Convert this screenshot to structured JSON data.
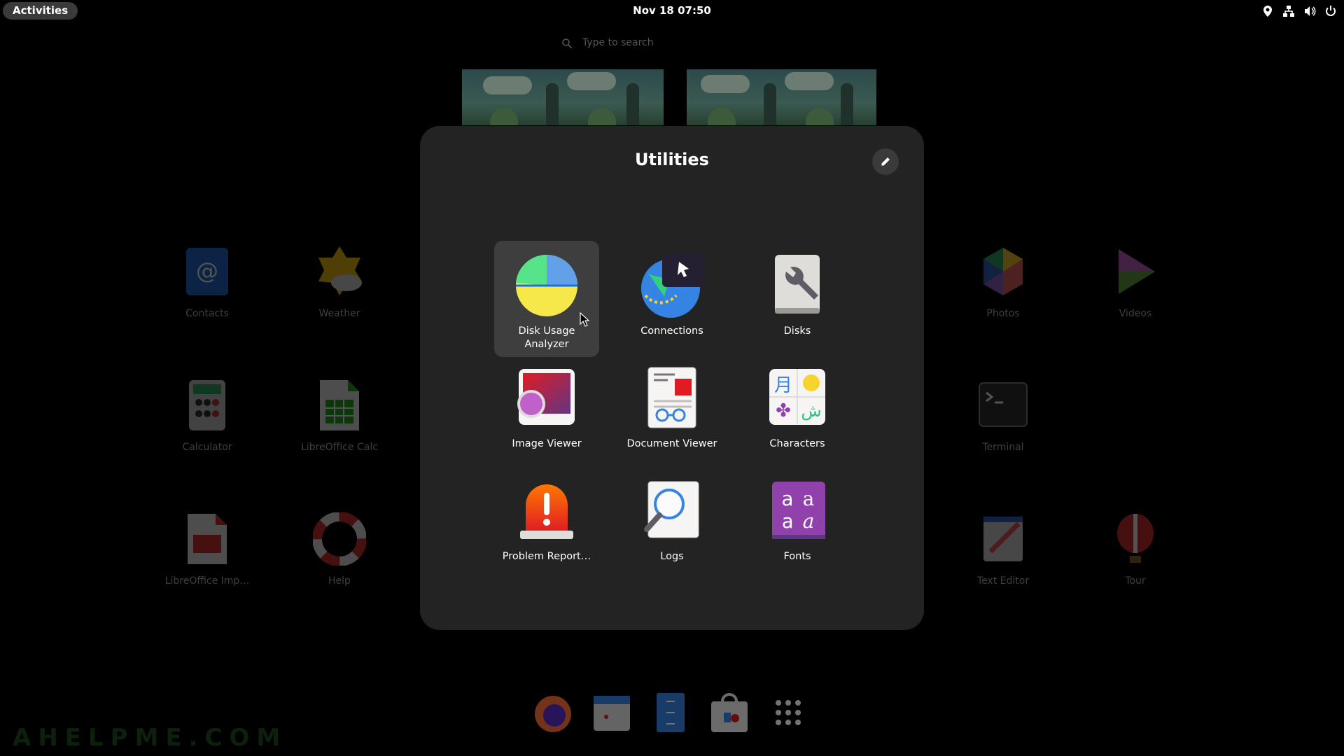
{
  "topbar": {
    "activities_label": "Activities",
    "clock": "Nov 18  07:50",
    "tray_icons": [
      "location-icon",
      "network-icon",
      "volume-icon",
      "power-icon"
    ]
  },
  "search": {
    "placeholder": "Type to search",
    "icon": "search-icon"
  },
  "background_apps": [
    {
      "label": "Contacts"
    },
    {
      "label": "Weather"
    },
    {
      "label": "Calculator"
    },
    {
      "label": "LibreOffice Calc"
    },
    {
      "label": "LibreOffice Imp…"
    },
    {
      "label": "Help"
    },
    {
      "label": "Photos"
    },
    {
      "label": "Videos"
    },
    {
      "label": "Terminal"
    },
    {
      "label": "Text Editor"
    },
    {
      "label": "Tour"
    }
  ],
  "folder": {
    "title": "Utilities",
    "edit_icon": "pencil-icon",
    "apps": [
      {
        "label": "Disk Usage\nAnalyzer",
        "icon": "disk-usage-analyzer-icon",
        "selected": true
      },
      {
        "label": "Connections",
        "icon": "connections-icon",
        "selected": false
      },
      {
        "label": "Disks",
        "icon": "disks-icon",
        "selected": false
      },
      {
        "label": "Image Viewer",
        "icon": "image-viewer-icon",
        "selected": false
      },
      {
        "label": "Document Viewer",
        "icon": "document-viewer-icon",
        "selected": false
      },
      {
        "label": "Characters",
        "icon": "characters-icon",
        "selected": false
      },
      {
        "label": "Problem Report…",
        "icon": "problem-reporting-icon",
        "selected": false
      },
      {
        "label": "Logs",
        "icon": "logs-icon",
        "selected": false
      },
      {
        "label": "Fonts",
        "icon": "fonts-icon",
        "selected": false
      }
    ]
  },
  "dash": {
    "items": [
      "firefox-icon",
      "calendar-icon",
      "files-icon",
      "software-icon",
      "show-apps-icon"
    ]
  },
  "watermark": "AHELPME.COM",
  "colors": {
    "folder_bg": "#232323",
    "selected_bg": "#3e3e3e",
    "activities_bg": "#3a3a3a"
  }
}
